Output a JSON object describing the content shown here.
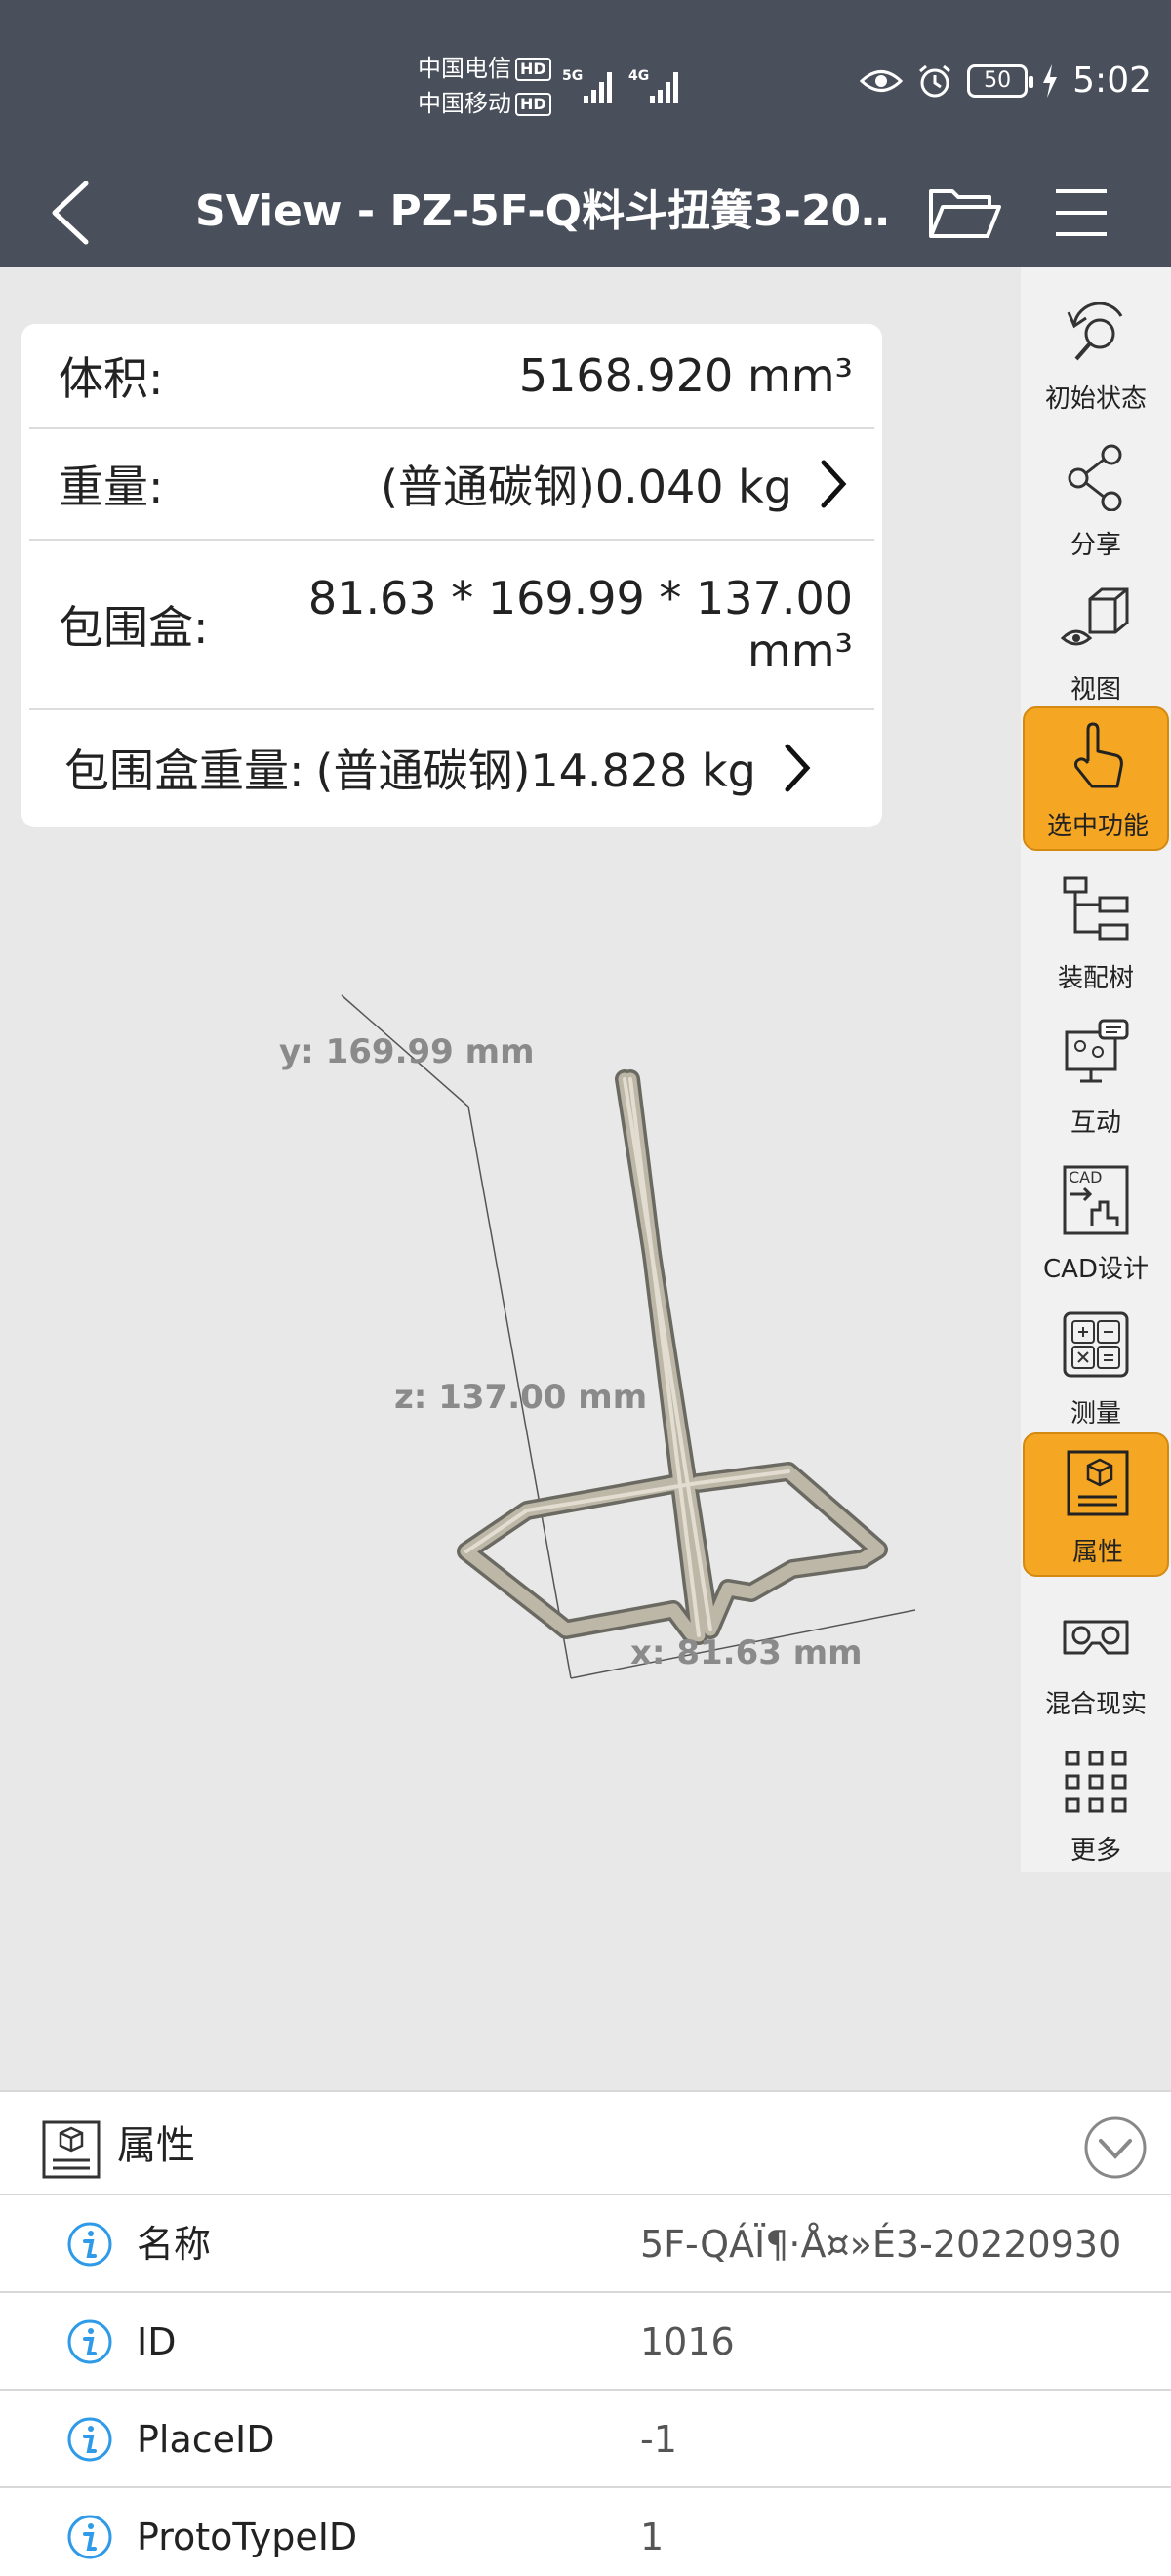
{
  "status_bar": {
    "carrier1": "中国电信",
    "carrier2": "中国移动",
    "hd_label": "HD",
    "net1": "5G",
    "net2": "4G",
    "battery": "50",
    "time": "5:02"
  },
  "header": {
    "title": "SView - PZ-5F-Q料斗扭簧3-20‥"
  },
  "info_card": {
    "volume_label": "体积:",
    "volume_value": "5168.920 mm³",
    "weight_label": "重量:",
    "weight_value": "(普通碳钢)0.040 kg",
    "bbox_label": "包围盒:",
    "bbox_value_line1": "81.63 * 169.99 * 137.00",
    "bbox_value_line2": "mm³",
    "bbox_weight_label": "包围盒重量:",
    "bbox_weight_value": "(普通碳钢)14.828 kg"
  },
  "toolbar": {
    "items": [
      {
        "label": "初始状态",
        "icon": "reset-view-icon",
        "active": false
      },
      {
        "label": "分享",
        "icon": "share-icon",
        "active": false
      },
      {
        "label": "视图",
        "icon": "view-cube-icon",
        "active": false
      },
      {
        "label": "选中功能",
        "icon": "hand-pointer-icon",
        "active": true
      },
      {
        "label": "装配树",
        "icon": "assembly-tree-icon",
        "active": false
      },
      {
        "label": "互动",
        "icon": "interaction-icon",
        "active": false
      },
      {
        "label": "CAD设计",
        "icon": "cad-design-icon",
        "active": false
      },
      {
        "label": "测量",
        "icon": "calculator-icon",
        "active": false
      },
      {
        "label": "属性",
        "icon": "properties-icon",
        "active": true
      },
      {
        "label": "混合现实",
        "icon": "vr-glasses-icon",
        "active": false
      },
      {
        "label": "更多",
        "icon": "more-grid-icon",
        "active": false
      }
    ],
    "cad_icon_text": "CAD"
  },
  "viewport": {
    "y_label": "y: 169.99 mm",
    "z_label": "z: 137.00 mm",
    "x_label": "x: 81.63 mm"
  },
  "properties_panel": {
    "title": "属性",
    "rows": [
      {
        "key": "名称",
        "value": "5F-QÁÏ¶·Å¤»É3-20220930"
      },
      {
        "key": "ID",
        "value": "1016"
      },
      {
        "key": "PlaceID",
        "value": "-1"
      },
      {
        "key": "ProtoTypeID",
        "value": "1"
      }
    ]
  },
  "colors": {
    "header_bg": "#4a505b",
    "active_orange": "#f5a623",
    "info_blue": "#2f9be8"
  }
}
